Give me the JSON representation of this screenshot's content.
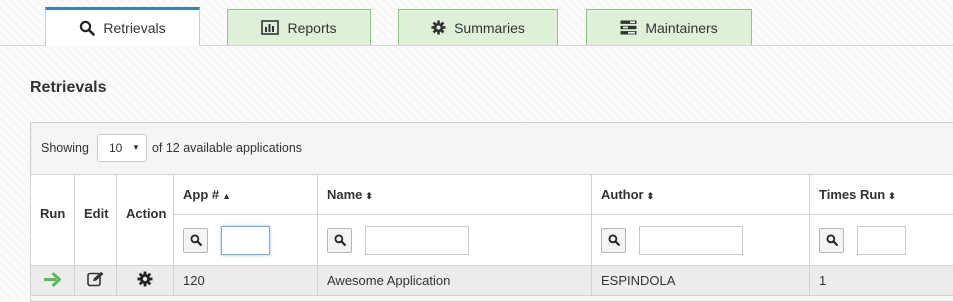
{
  "tabs": [
    {
      "label": "Retrievals",
      "icon": "search-icon",
      "active": true
    },
    {
      "label": "Reports",
      "icon": "bar-chart-icon",
      "active": false
    },
    {
      "label": "Summaries",
      "icon": "gear-icon",
      "active": false
    },
    {
      "label": "Maintainers",
      "icon": "tasks-icon",
      "active": false
    }
  ],
  "heading": "Retrievals",
  "length_menu": {
    "prefix": "Showing",
    "value": "10",
    "suffix": "of 12 available applications"
  },
  "columns": {
    "run": "Run",
    "edit": "Edit",
    "action": "Action",
    "app_no": "App #",
    "name": "Name",
    "author": "Author",
    "times_run": "Times Run"
  },
  "sort": {
    "asc": "▲",
    "both": "⬍"
  },
  "rows": [
    {
      "app_no": "120",
      "name": "Awesome Application",
      "author": "ESPINDOLA",
      "times_run": "1"
    }
  ],
  "colors": {
    "accent": "#3f80b6",
    "tab_green": "#dff0d8",
    "run_arrow": "#5cb85c"
  }
}
